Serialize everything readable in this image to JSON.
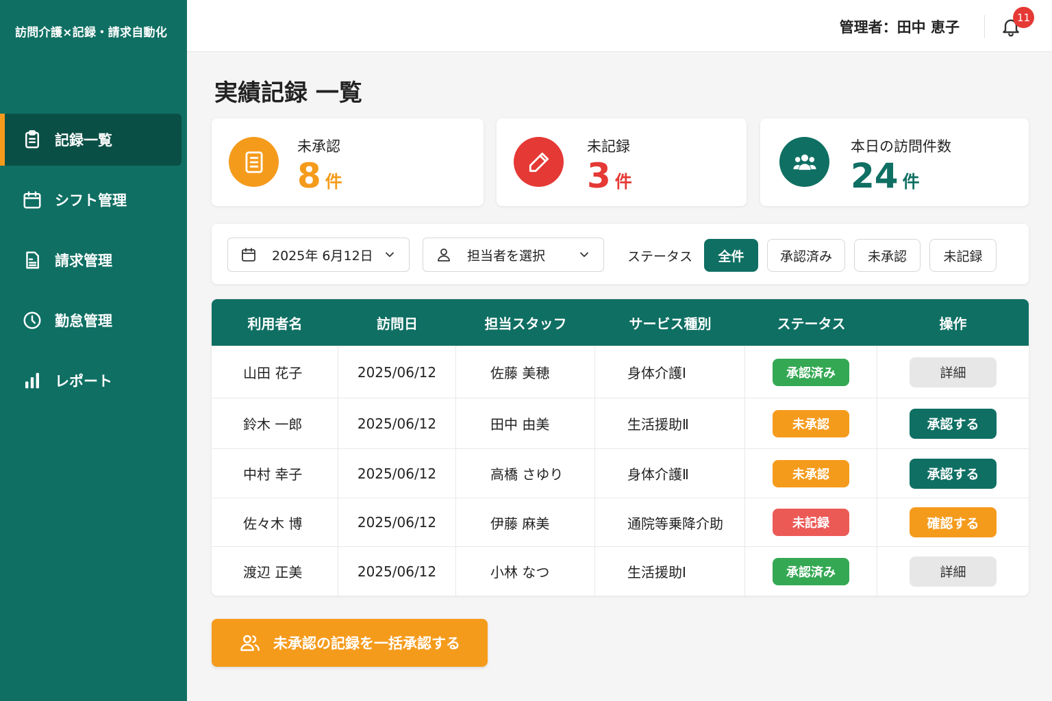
{
  "app": {
    "title": "訪問介護×記録・請求自動化"
  },
  "sidebar": {
    "items": [
      {
        "label": "記録一覧",
        "icon": "clipboard-icon",
        "active": true
      },
      {
        "label": "シフト管理",
        "icon": "calendar-icon",
        "active": false
      },
      {
        "label": "請求管理",
        "icon": "invoice-icon",
        "active": false
      },
      {
        "label": "勤怠管理",
        "icon": "clock-icon",
        "active": false
      },
      {
        "label": "レポート",
        "icon": "bar-chart-icon",
        "active": false
      }
    ]
  },
  "header": {
    "admin": "管理者：田中 恵子",
    "notification_count": "11"
  },
  "page": {
    "title": "実績記録 一覧"
  },
  "stats": [
    {
      "label": "未承認",
      "value": "8",
      "unit": "件",
      "color": "#f59b1c",
      "icon": "document-icon"
    },
    {
      "label": "未記録",
      "value": "3",
      "unit": "件",
      "color": "#e53935",
      "icon": "pencil-icon"
    },
    {
      "label": "本日の訪問件数",
      "value": "24",
      "unit": "件",
      "color": "#0f6f63",
      "icon": "users-icon"
    }
  ],
  "filters": {
    "date": "2025年 6月12日",
    "staff_placeholder": "担当者を選択",
    "status_label": "ステータス",
    "status_options": [
      "全件",
      "承認済み",
      "未承認",
      "未記録"
    ],
    "status_selected": "全件"
  },
  "table": {
    "headers": [
      "利用者名",
      "訪問日",
      "担当スタッフ",
      "サービス種別",
      "ステータス",
      "操作"
    ],
    "rows": [
      {
        "user": "山田 花子",
        "date": "2025/06/12",
        "staff": "佐藤 美穂",
        "service": "身体介護Ⅰ",
        "status": "承認済み",
        "action": "詳細"
      },
      {
        "user": "鈴木 一郎",
        "date": "2025/06/12",
        "staff": "田中 由美",
        "service": "生活援助Ⅱ",
        "status": "未承認",
        "action": "承認する"
      },
      {
        "user": "中村 幸子",
        "date": "2025/06/12",
        "staff": "高橋 さゆり",
        "service": "身体介護Ⅱ",
        "status": "未承認",
        "action": "承認する"
      },
      {
        "user": "佐々木 博",
        "date": "2025/06/12",
        "staff": "伊藤 麻美",
        "service": "通院等乗降介助",
        "status": "未記録",
        "action": "確認する"
      },
      {
        "user": "渡辺 正美",
        "date": "2025/06/12",
        "staff": "小林 なつ",
        "service": "生活援助Ⅰ",
        "status": "承認済み",
        "action": "詳細"
      }
    ]
  },
  "status_colors": {
    "承認済み": "#34a853",
    "未承認": "#f59b1c",
    "未記録": "#ec5a56"
  },
  "bulk_action": {
    "label": "未承認の記録を一括承認する",
    "icon": "users-outline-icon"
  }
}
